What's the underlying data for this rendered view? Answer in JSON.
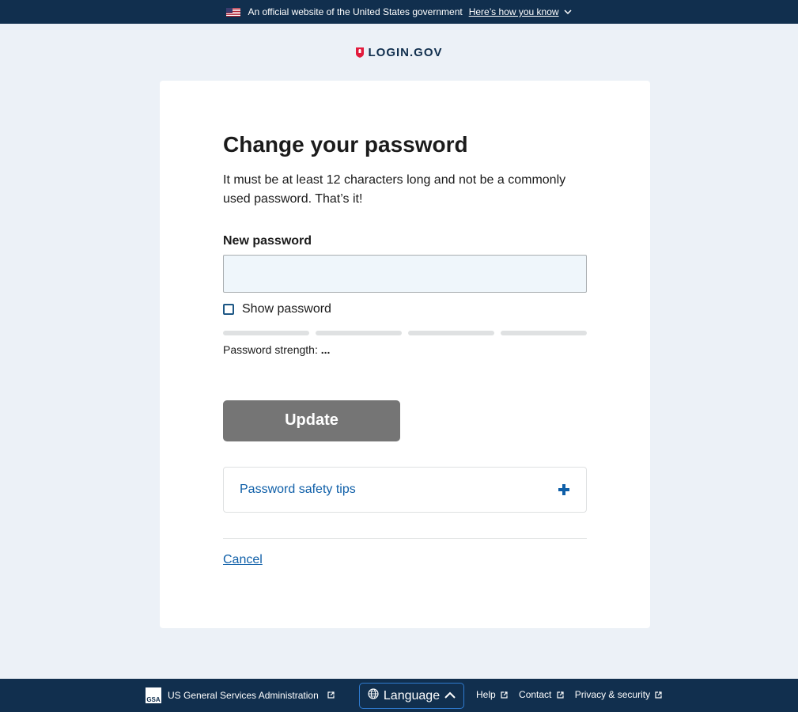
{
  "banner": {
    "official_text": "An official website of the United States government",
    "how_know_text": "Here’s how you know",
    "flag_icon": "us-flag-icon",
    "chevron_icon": "chevron-down-icon"
  },
  "logo": {
    "text": "LOGIN.GOV",
    "icon": "shield-icon",
    "brand_color": "#e21c3d"
  },
  "main": {
    "title": "Change your password",
    "intro": "It must be at least 12 characters long and not be a commonly used password. That’s it!",
    "new_password_label": "New password",
    "new_password_value": "",
    "show_password_label": "Show password",
    "show_password_checked": false,
    "strength_label": "Password strength:",
    "strength_value": "...",
    "update_label": "Update",
    "accordion_label": "Password safety tips",
    "accordion_icon": "plus-icon",
    "cancel_label": "Cancel"
  },
  "footer": {
    "gsa_label": "US General Services Administration",
    "gsa_logo_text": "GSA",
    "language_label": "Language",
    "links": [
      "Help",
      "Contact",
      "Privacy & security"
    ]
  },
  "colors": {
    "navy": "#112f4e",
    "link_blue": "#0f5fa8",
    "button_gray": "#757575",
    "page_bg": "#ecf1f7",
    "input_bg": "#eff6fb"
  }
}
